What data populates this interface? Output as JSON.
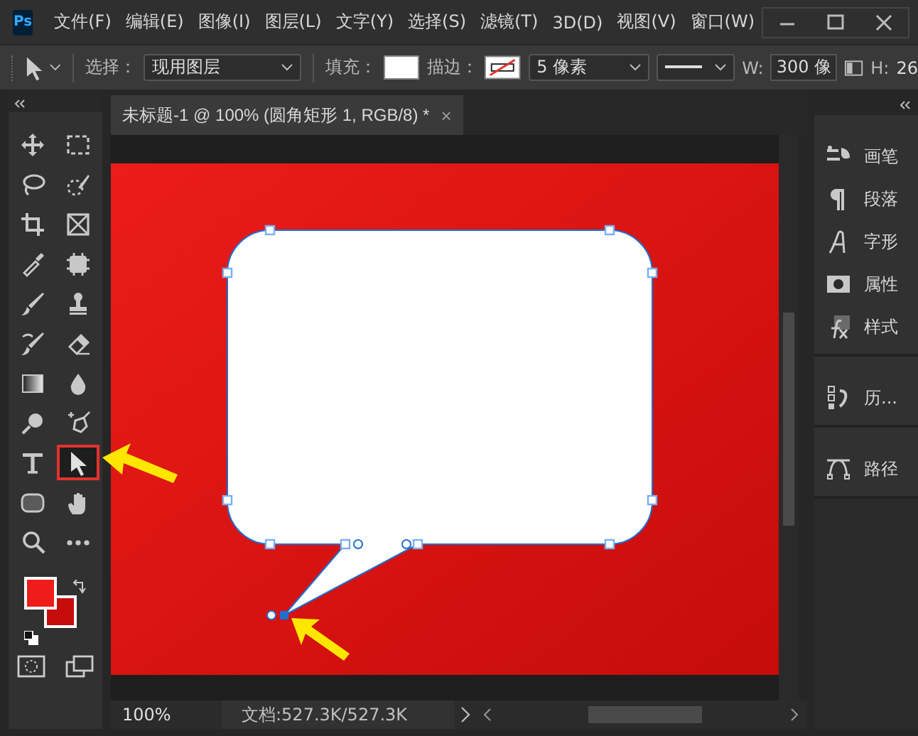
{
  "app": {
    "logo": "Ps"
  },
  "menu": [
    "文件(F)",
    "编辑(E)",
    "图像(I)",
    "图层(L)",
    "文字(Y)",
    "选择(S)",
    "滤镜(T)",
    "3D(D)",
    "视图(V)",
    "窗口(W)"
  ],
  "options_bar": {
    "select_label": "选择：",
    "select_value": "现用图层",
    "fill_label": "填充：",
    "stroke_label": "描边：",
    "stroke_width": "5 像素",
    "w_label": "W:",
    "w_value": "300 像",
    "h_label": "H:",
    "h_value": "26"
  },
  "document_tab": {
    "title": "未标题-1 @ 100% (圆角矩形 1, RGB/8) *",
    "close": "×"
  },
  "tools": [
    {
      "kind": "move",
      "selected": false,
      "highlighted": false
    },
    {
      "kind": "marquee",
      "selected": false,
      "highlighted": false
    },
    {
      "kind": "lasso",
      "selected": false,
      "highlighted": false
    },
    {
      "kind": "quick-select",
      "selected": false,
      "highlighted": false
    },
    {
      "kind": "crop",
      "selected": false,
      "highlighted": false
    },
    {
      "kind": "frame",
      "selected": false,
      "highlighted": false
    },
    {
      "kind": "eyedropper",
      "selected": false,
      "highlighted": false
    },
    {
      "kind": "healing",
      "selected": false,
      "highlighted": false
    },
    {
      "kind": "brush",
      "selected": false,
      "highlighted": false
    },
    {
      "kind": "stamp",
      "selected": false,
      "highlighted": false
    },
    {
      "kind": "history-brush",
      "selected": false,
      "highlighted": false
    },
    {
      "kind": "eraser",
      "selected": false,
      "highlighted": false
    },
    {
      "kind": "gradient",
      "selected": false,
      "highlighted": false
    },
    {
      "kind": "blur",
      "selected": false,
      "highlighted": false
    },
    {
      "kind": "dodge",
      "selected": false,
      "highlighted": false
    },
    {
      "kind": "pen",
      "selected": false,
      "highlighted": false
    },
    {
      "kind": "type",
      "selected": false,
      "highlighted": false
    },
    {
      "kind": "direct-select",
      "selected": true,
      "highlighted": true
    },
    {
      "kind": "shape",
      "selected": false,
      "highlighted": false
    },
    {
      "kind": "hand",
      "selected": false,
      "highlighted": false
    },
    {
      "kind": "zoom",
      "selected": false,
      "highlighted": false
    },
    {
      "kind": "more",
      "selected": false,
      "highlighted": false
    }
  ],
  "panels": [
    [
      {
        "label": "画笔",
        "kind": "brush-settings"
      },
      {
        "label": "段落",
        "kind": "paragraph"
      },
      {
        "label": "字形",
        "kind": "glyphs"
      },
      {
        "label": "属性",
        "kind": "properties"
      },
      {
        "label": "样式",
        "kind": "styles"
      }
    ],
    [
      {
        "label": "历...",
        "kind": "history"
      }
    ],
    [
      {
        "label": "路径",
        "kind": "paths"
      }
    ]
  ],
  "status_bar": {
    "zoom": "100%",
    "doc_info": "文档:527.3K/527.3K"
  }
}
